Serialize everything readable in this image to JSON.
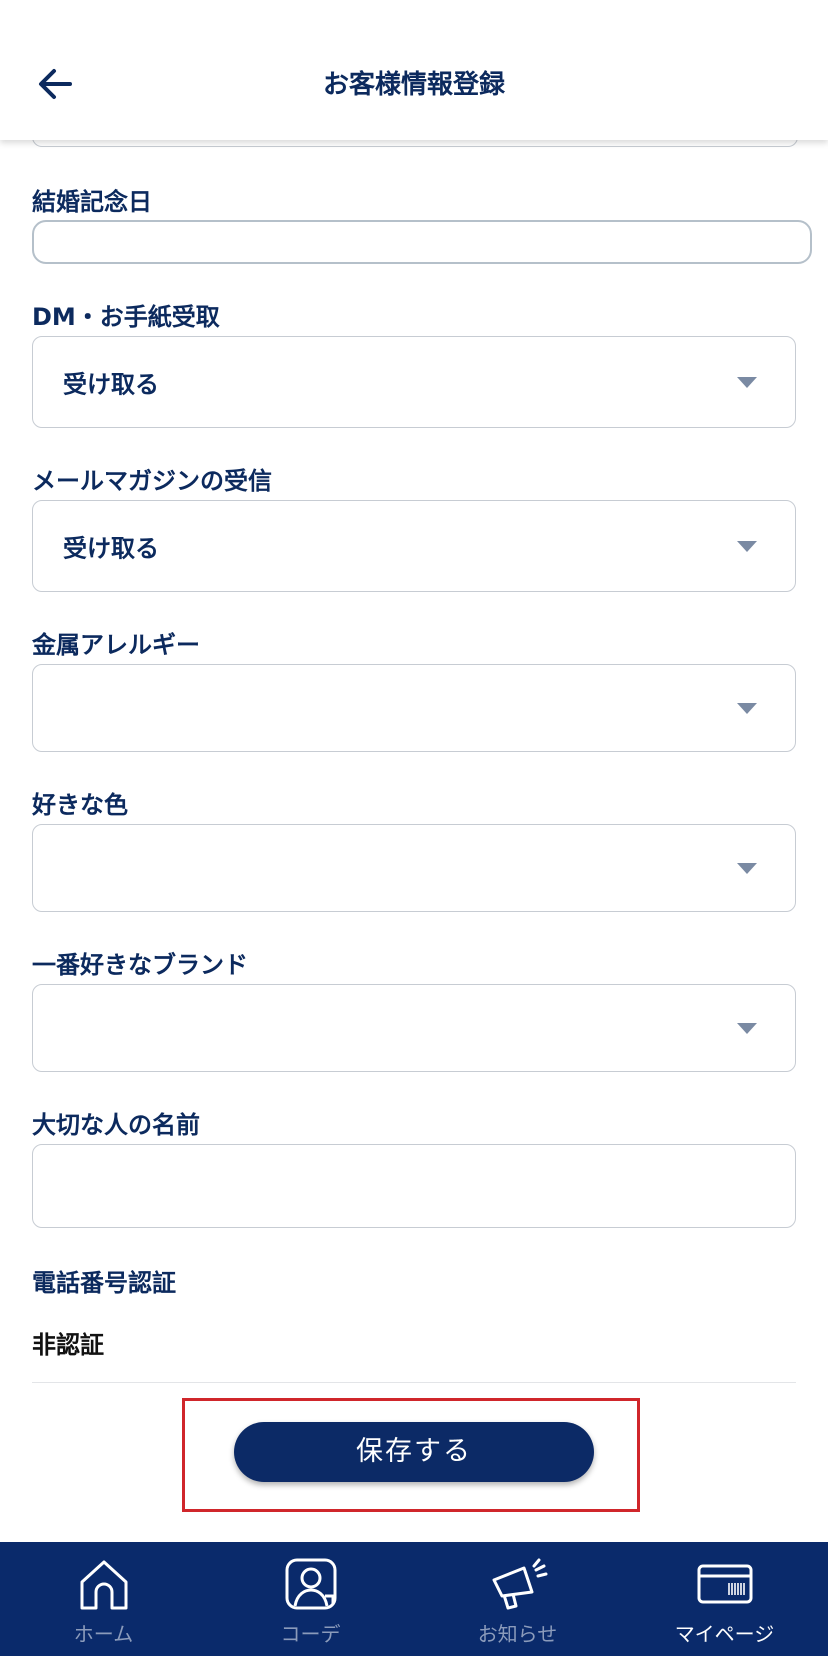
{
  "header": {
    "title": "お客様情報登録"
  },
  "fields": {
    "anniversary": {
      "label": "結婚記念日",
      "value": ""
    },
    "dm": {
      "label": "DM・お手紙受取",
      "value": "受け取る"
    },
    "mail": {
      "label": "メールマガジンの受信",
      "value": "受け取る"
    },
    "allergy": {
      "label": "金属アレルギー",
      "value": ""
    },
    "color": {
      "label": "好きな色",
      "value": ""
    },
    "brand": {
      "label": "一番好きなブランド",
      "value": ""
    },
    "important_person": {
      "label": "大切な人の名前",
      "value": ""
    },
    "phone_auth": {
      "label": "電話番号認証",
      "value": "非認証"
    }
  },
  "save_button": "保存する",
  "tabbar": {
    "items": [
      {
        "label": "ホーム",
        "icon": "home-icon"
      },
      {
        "label": "コーデ",
        "icon": "person-card-icon"
      },
      {
        "label": "お知らせ",
        "icon": "megaphone-icon"
      },
      {
        "label": "マイページ",
        "icon": "card-icon"
      }
    ],
    "active_index": 3
  },
  "colors": {
    "navy": "#0c2a5e",
    "tabbar": "#0a2a6b",
    "highlight": "#d0262b",
    "tab_inactive": "#8b9bbb"
  }
}
